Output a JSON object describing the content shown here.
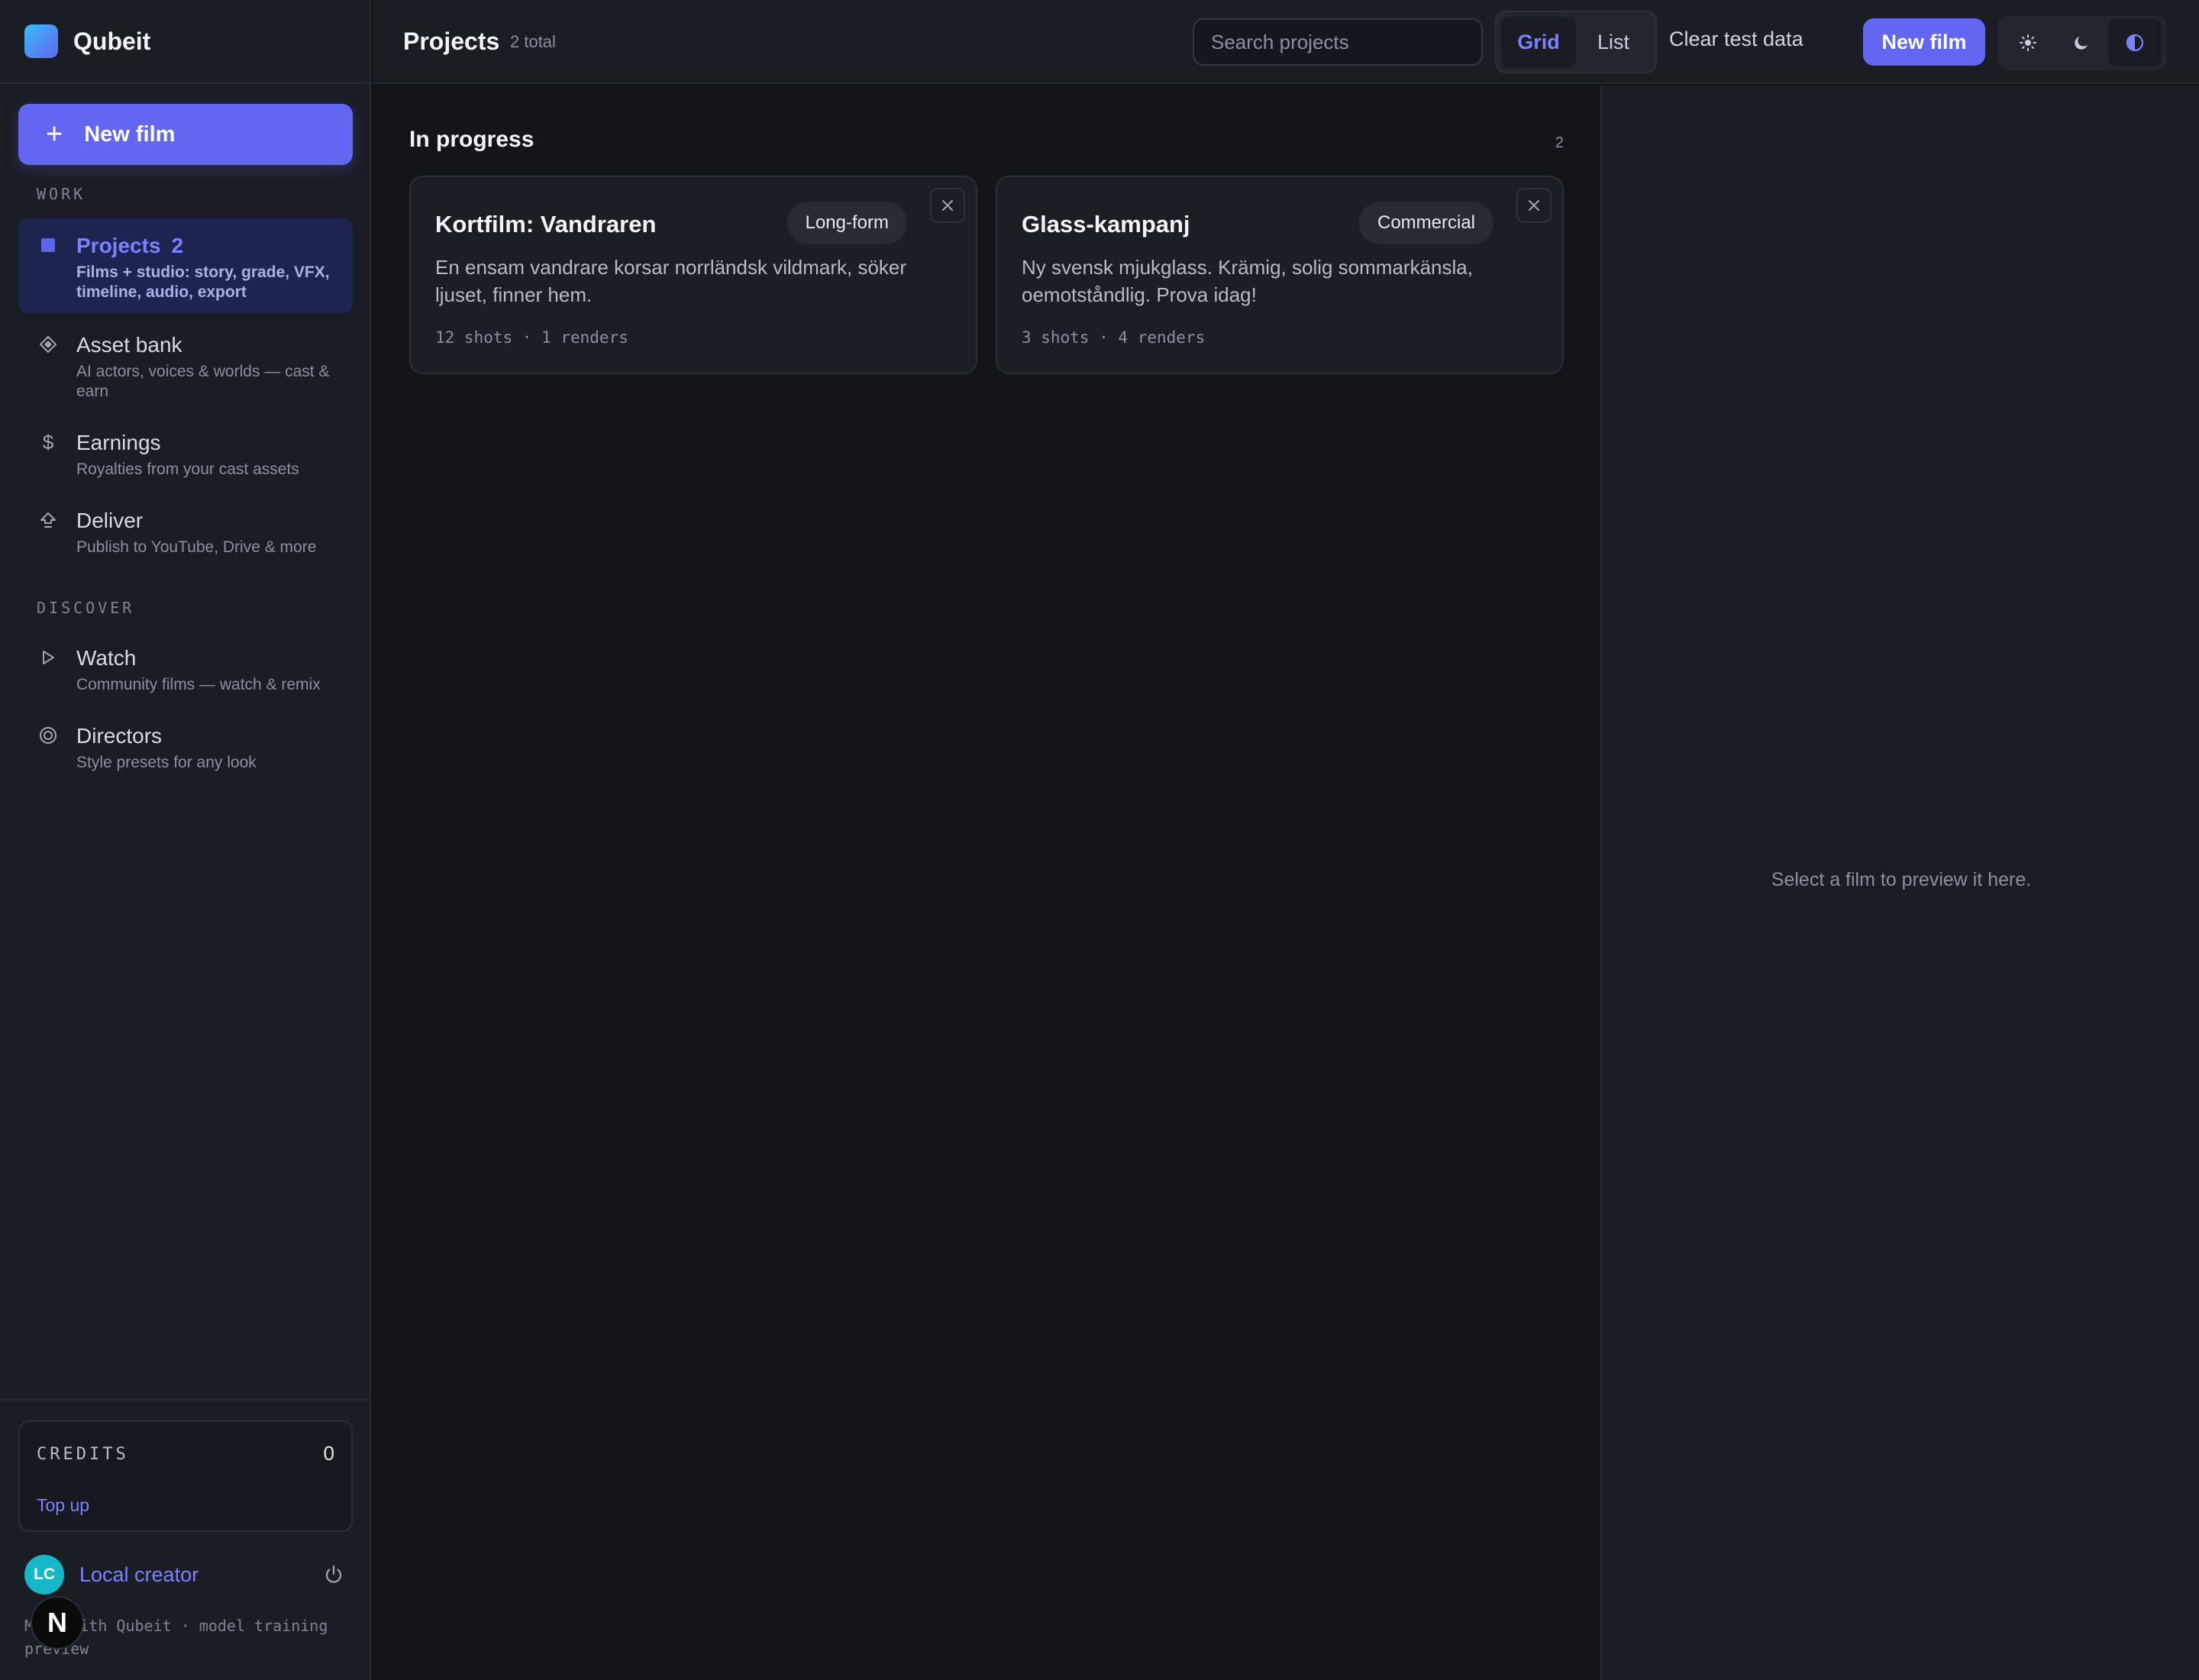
{
  "app": {
    "name": "Qubeit",
    "brand_color": "#6366f1"
  },
  "sidebar": {
    "new_film_label": "New film",
    "sections": {
      "work": "WORK",
      "discover": "DISCOVER"
    },
    "items": [
      {
        "title": "Projects",
        "count": "2",
        "subtitle": "Films + studio: story, grade, VFX, timeline, audio, export",
        "icon": "square-icon",
        "active": true
      },
      {
        "title": "Asset bank",
        "subtitle": "AI actors, voices & worlds — cast & earn",
        "icon": "diamond-icon"
      },
      {
        "title": "Earnings",
        "subtitle": "Royalties from your cast assets",
        "icon": "dollar-icon"
      },
      {
        "title": "Deliver",
        "subtitle": "Publish to YouTube, Drive & more",
        "icon": "upload-icon"
      },
      {
        "title": "Watch",
        "subtitle": "Community films — watch & remix",
        "icon": "play-icon"
      },
      {
        "title": "Directors",
        "subtitle": "Style presets for any look",
        "icon": "target-icon"
      }
    ],
    "credits": {
      "label": "CREDITS",
      "value": "0",
      "top_up": "Top up"
    },
    "user": {
      "initials": "LC",
      "name": "Local creator"
    },
    "footer_note": "Made with Qubeit · model training preview",
    "badge": "N"
  },
  "header": {
    "title": "Projects",
    "count": "2 total",
    "search_placeholder": "Search projects",
    "view_grid": "Grid",
    "view_list": "List",
    "clear_label": "Clear test data",
    "new_film_label": "New film"
  },
  "main": {
    "section_title": "In progress",
    "section_count": "2",
    "cards": [
      {
        "title": "Kortfilm: Vandraren",
        "tag": "Long-form",
        "description": "En ensam vandrare korsar norrländsk vildmark, söker ljuset, finner hem.",
        "meta": "12 shots · 1 renders"
      },
      {
        "title": "Glass-kampanj",
        "tag": "Commercial",
        "description": "Ny svensk mjukglass. Krämig, solig sommarkänsla, oemotståndlig. Prova idag!",
        "meta": "3 shots · 4 renders"
      }
    ]
  },
  "preview": {
    "empty_message": "Select a film to preview it here."
  }
}
